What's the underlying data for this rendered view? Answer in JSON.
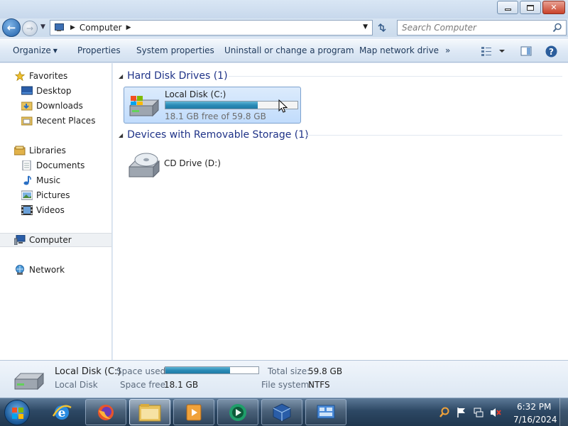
{
  "window": {
    "controls": {
      "minimize": "minimize",
      "maximize": "maximize",
      "close": "close"
    }
  },
  "address_bar": {
    "crumb": "Computer",
    "search_placeholder": "Search Computer"
  },
  "command_bar": {
    "organize": "Organize",
    "properties": "Properties",
    "system_properties": "System properties",
    "uninstall": "Uninstall or change a program",
    "map_drive": "Map network drive",
    "more": "»"
  },
  "nav_pane": {
    "favorites": "Favorites",
    "desktop": "Desktop",
    "downloads": "Downloads",
    "recent_places": "Recent Places",
    "libraries": "Libraries",
    "documents": "Documents",
    "music": "Music",
    "pictures": "Pictures",
    "videos": "Videos",
    "computer": "Computer",
    "network": "Network"
  },
  "content": {
    "hdd_group": "Hard Disk Drives (1)",
    "removable_group": "Devices with Removable Storage (1)",
    "local_disk": {
      "name": "Local Disk (C:)",
      "free_text": "18.1 GB free of 59.8 GB",
      "used_fraction": 0.697
    },
    "cd_drive": {
      "name": "CD Drive (D:)"
    }
  },
  "details_pane": {
    "name": "Local Disk (C:)",
    "type": "Local Disk",
    "space_used_label": "Space used:",
    "space_free_label": "Space free:",
    "space_free_value": "18.1 GB",
    "total_size_label": "Total size:",
    "total_size_value": "59.8 GB",
    "file_system_label": "File system:",
    "file_system_value": "NTFS",
    "used_fraction": 0.697
  },
  "taskbar": {
    "time": "6:32 PM",
    "date": "7/16/2024"
  },
  "colors": {
    "accent_blue": "#1e3287",
    "bar_fill": "#2a8bb7",
    "selection": "#c1dcfc"
  }
}
